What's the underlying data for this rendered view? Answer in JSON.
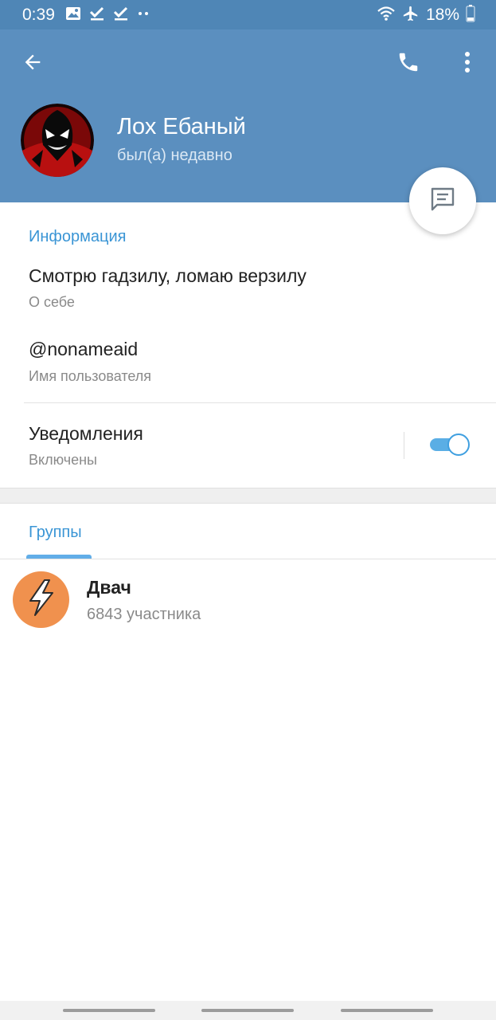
{
  "status_bar": {
    "time": "0:39",
    "battery": "18%",
    "icons_left": [
      "image-icon",
      "check-icon",
      "check-icon",
      "more-dots-icon"
    ],
    "icons_right": [
      "wifi-icon",
      "airplane-icon",
      "battery-icon"
    ]
  },
  "header": {
    "name": "Лох Ебаный",
    "status": "был(а) недавно",
    "background_color": "#5b8fbf",
    "icons": [
      "back-arrow-icon",
      "phone-icon",
      "more-vert-icon"
    ]
  },
  "info": {
    "title": "Информация",
    "bio_value": "Смотрю гадзилу, ломаю верзилу",
    "bio_label": "О себе",
    "username_value": "@nonameaid",
    "username_label": "Имя пользователя",
    "notifications_value": "Уведомления",
    "notifications_label": "Включены",
    "notifications_enabled": true
  },
  "groups": {
    "title": "Группы",
    "items": [
      {
        "name": "Двач",
        "members": "6843 участника",
        "avatar_color": "#f0914e",
        "icon": "lightning-icon"
      }
    ]
  },
  "colors": {
    "accent": "#3a95d5",
    "header": "#5b8fbf",
    "status_bar": "#4f86b6"
  }
}
